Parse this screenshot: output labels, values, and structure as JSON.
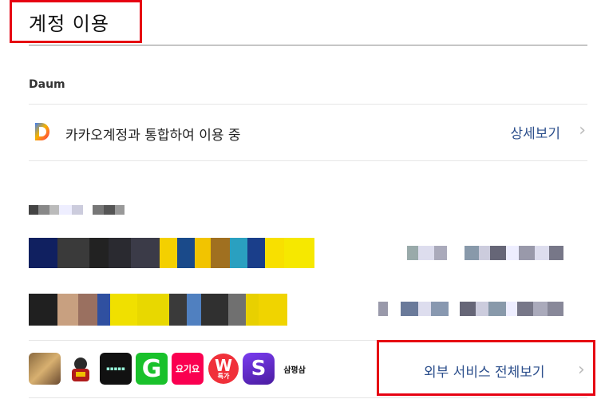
{
  "page": {
    "title": "계정 이용"
  },
  "daum": {
    "section_label": "Daum",
    "status_text": "카카오계정과 통합하여 이용 중",
    "detail_label": "상세보기",
    "icon": "daum-logo-icon"
  },
  "apps": {
    "icons": [
      "app-photo-icon",
      "app-character-icon",
      "app-dark-banner-icon",
      "app-green-g-icon",
      "app-yogiyo-icon",
      "app-w-sale-icon",
      "app-s-purple-icon",
      "app-sampyeongsam-icon"
    ],
    "labels": {
      "yogiyo": "요기요",
      "w_top": "W",
      "w_bottom": "특가",
      "s": "S",
      "sam": "삼평삼",
      "g": "G"
    },
    "more_label": "외부 서비스 전체보기"
  },
  "colors": {
    "accent_red": "#e60012",
    "link_blue": "#2c4f8c",
    "divider": "#e6e6e6"
  }
}
